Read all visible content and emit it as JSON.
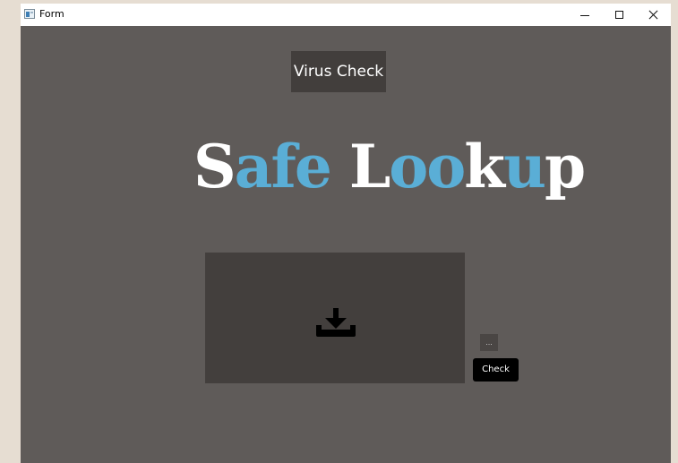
{
  "window": {
    "title": "Form",
    "icon": "form-app-icon",
    "controls": {
      "minimize_icon": "minimize-icon",
      "maximize_icon": "maximize-icon",
      "close_icon": "close-icon"
    }
  },
  "header": {
    "label": "Virus Check"
  },
  "logo": {
    "text": "Safe Lookup",
    "letters": [
      {
        "ch": "S",
        "color": "#ffffff"
      },
      {
        "ch": "a",
        "color": "#5aaed6"
      },
      {
        "ch": "f",
        "color": "#5aaed6"
      },
      {
        "ch": "e",
        "color": "#5aaed6"
      },
      {
        "ch": " ",
        "color": "#ffffff"
      },
      {
        "ch": "L",
        "color": "#ffffff"
      },
      {
        "ch": "o",
        "color": "#5aaed6"
      },
      {
        "ch": "o",
        "color": "#5aaed6"
      },
      {
        "ch": "k",
        "color": "#ffffff"
      },
      {
        "ch": "u",
        "color": "#5aaed6"
      },
      {
        "ch": "p",
        "color": "#ffffff"
      }
    ]
  },
  "drop_zone": {
    "icon": "download-icon"
  },
  "buttons": {
    "browse_label": "...",
    "check_label": "Check"
  },
  "colors": {
    "background": "#5f5b59",
    "panel": "#433f3d",
    "header_bg": "#423e3c",
    "accent": "#5aaed6",
    "check_button": "#000000"
  }
}
